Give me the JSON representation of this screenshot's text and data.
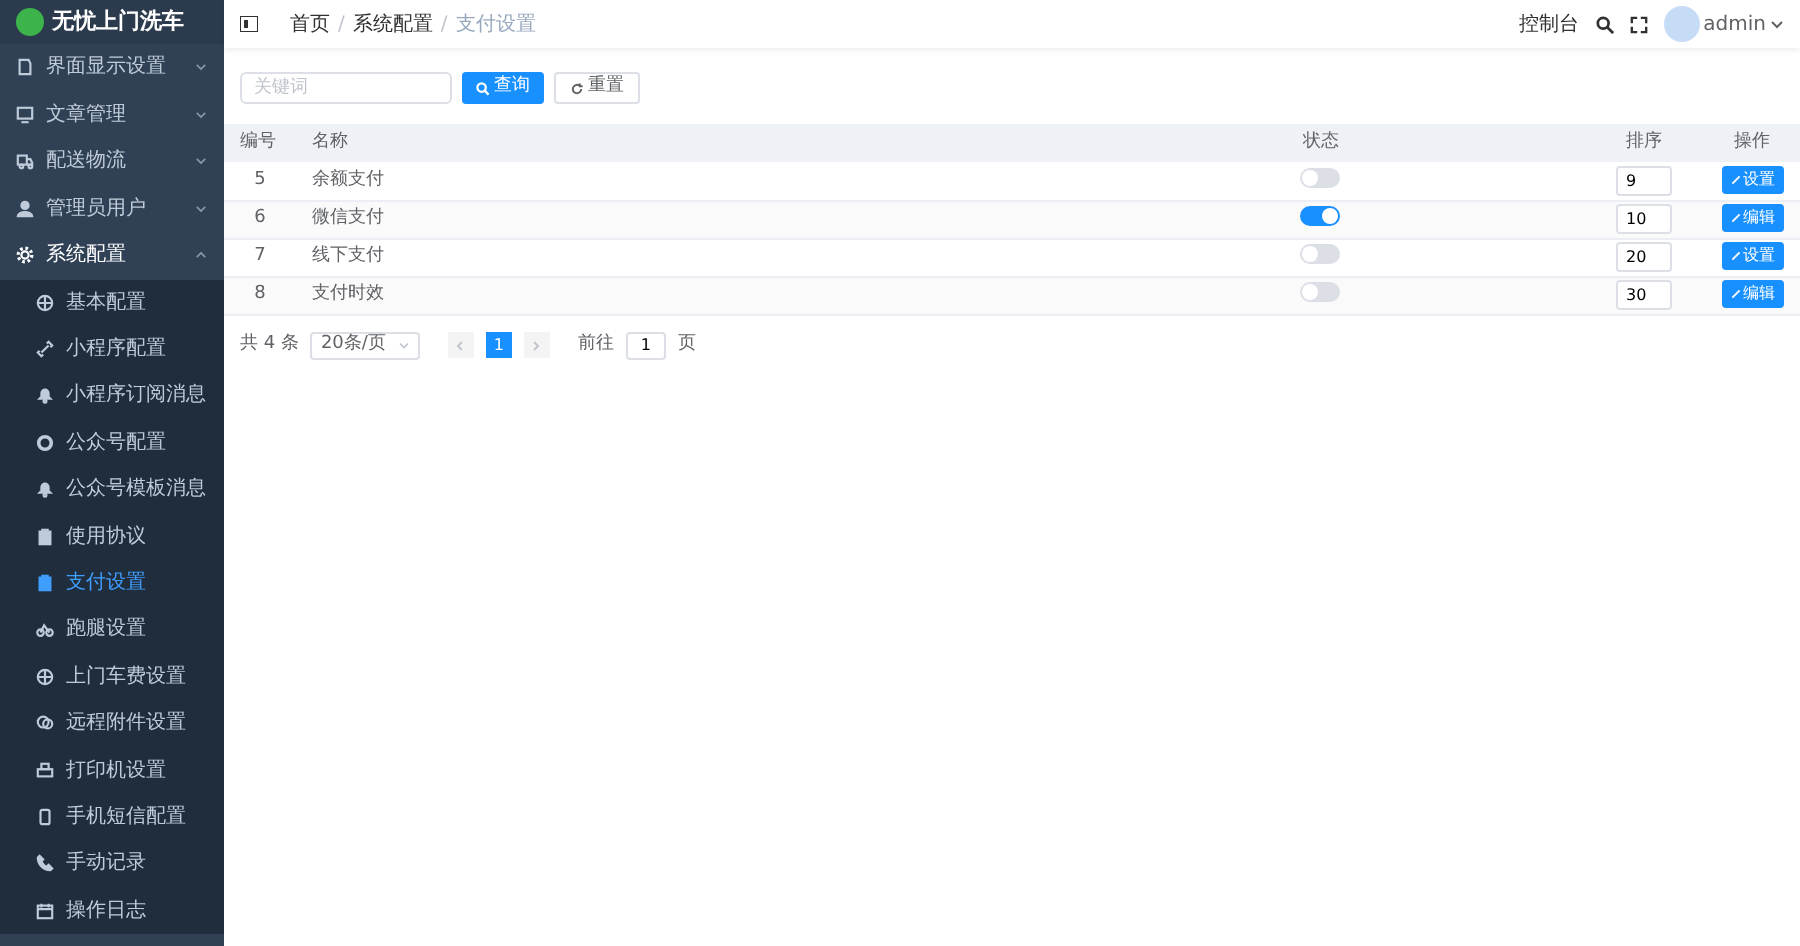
{
  "brand": {
    "title": "无忧上门洗车"
  },
  "sidebar": {
    "items": [
      {
        "label": "界面显示设置",
        "expanded": false
      },
      {
        "label": "文章管理",
        "expanded": false
      },
      {
        "label": "配送物流",
        "expanded": false
      },
      {
        "label": "管理员用户",
        "expanded": false
      },
      {
        "label": "系统配置",
        "expanded": true,
        "children": [
          {
            "label": "基本配置",
            "selected": false
          },
          {
            "label": "小程序配置",
            "selected": false
          },
          {
            "label": "小程序订阅消息",
            "selected": false
          },
          {
            "label": "公众号配置",
            "selected": false
          },
          {
            "label": "公众号模板消息",
            "selected": false
          },
          {
            "label": "使用协议",
            "selected": false
          },
          {
            "label": "支付设置",
            "selected": true
          },
          {
            "label": "跑腿设置",
            "selected": false
          },
          {
            "label": "上门车费设置",
            "selected": false
          },
          {
            "label": "远程附件设置",
            "selected": false
          },
          {
            "label": "打印机设置",
            "selected": false
          },
          {
            "label": "手机短信配置",
            "selected": false
          },
          {
            "label": "手动记录",
            "selected": false
          },
          {
            "label": "操作日志",
            "selected": false
          }
        ]
      }
    ]
  },
  "breadcrumb": [
    {
      "label": "首页"
    },
    {
      "separator": "/",
      "label": "系统配置"
    },
    {
      "separator": "/",
      "label": "支付设置"
    }
  ],
  "header": {
    "console": "控制台",
    "user": "admin"
  },
  "search": {
    "placeholder": "关键词",
    "query_button": "查询",
    "reset_button": "重置"
  },
  "table": {
    "columns": [
      "编号",
      "名称",
      "状态",
      "排序",
      "操作"
    ],
    "rows": [
      {
        "id": "5",
        "name": "余额支付",
        "on": false,
        "sort": "9",
        "action": "设置"
      },
      {
        "id": "6",
        "name": "微信支付",
        "on": true,
        "sort": "10",
        "action": "编辑"
      },
      {
        "id": "7",
        "name": "线下支付",
        "on": false,
        "sort": "20",
        "action": "设置"
      },
      {
        "id": "8",
        "name": "支付时效",
        "on": false,
        "sort": "30",
        "action": "编辑"
      }
    ]
  },
  "pagination": {
    "total": "共 4 条",
    "page_size": "20条/页",
    "pages": [
      {
        "label": "1",
        "selected": true
      }
    ],
    "goto_label": "前往",
    "goto_value": "1",
    "goto_suffix": "页"
  }
}
